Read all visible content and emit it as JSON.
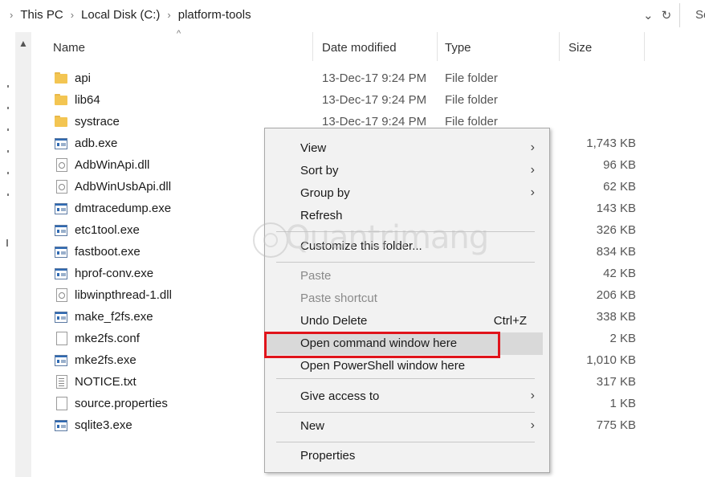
{
  "address": {
    "crumbs": [
      "This PC",
      "Local Disk (C:)",
      "platform-tools"
    ],
    "search_hint": "Se"
  },
  "columns": {
    "name": "Name",
    "date": "Date modified",
    "type": "Type",
    "size": "Size"
  },
  "files": [
    {
      "icon": "folder-icon",
      "name": "api",
      "date": "13-Dec-17 9:24 PM",
      "type": "File folder",
      "size": ""
    },
    {
      "icon": "folder-icon",
      "name": "lib64",
      "date": "13-Dec-17 9:24 PM",
      "type": "File folder",
      "size": ""
    },
    {
      "icon": "folder-icon",
      "name": "systrace",
      "date": "13-Dec-17 9:24 PM",
      "type": "File folder",
      "size": ""
    },
    {
      "icon": "exe-icon",
      "name": "adb.exe",
      "date": "",
      "type": "",
      "size": "1,743 KB"
    },
    {
      "icon": "dll-icon",
      "name": "AdbWinApi.dll",
      "date": "",
      "type": "",
      "size": "96 KB"
    },
    {
      "icon": "dll-icon",
      "name": "AdbWinUsbApi.dll",
      "date": "",
      "type": "",
      "size": "62 KB"
    },
    {
      "icon": "exe-icon",
      "name": "dmtracedump.exe",
      "date": "",
      "type": "",
      "size": "143 KB"
    },
    {
      "icon": "exe-icon",
      "name": "etc1tool.exe",
      "date": "",
      "type": "",
      "size": "326 KB"
    },
    {
      "icon": "exe-icon",
      "name": "fastboot.exe",
      "date": "",
      "type": "",
      "size": "834 KB"
    },
    {
      "icon": "exe-icon",
      "name": "hprof-conv.exe",
      "date": "",
      "type": "",
      "size": "42 KB"
    },
    {
      "icon": "dll-icon",
      "name": "libwinpthread-1.dll",
      "date": "",
      "type": "",
      "size": "206 KB"
    },
    {
      "icon": "exe-icon",
      "name": "make_f2fs.exe",
      "date": "",
      "type": "",
      "size": "338 KB"
    },
    {
      "icon": "document-icon",
      "name": "mke2fs.conf",
      "date": "",
      "type": "",
      "size": "2 KB"
    },
    {
      "icon": "exe-icon",
      "name": "mke2fs.exe",
      "date": "",
      "type": "",
      "size": "1,010 KB"
    },
    {
      "icon": "text-file-icon",
      "name": "NOTICE.txt",
      "date": "",
      "type": "",
      "size": "317 KB"
    },
    {
      "icon": "document-icon",
      "name": "source.properties",
      "date": "",
      "type": "",
      "size": "1 KB"
    },
    {
      "icon": "exe-icon",
      "name": "sqlite3.exe",
      "date": "",
      "type": "",
      "size": "775 KB"
    }
  ],
  "menu": {
    "view": "View",
    "sort_by": "Sort by",
    "group_by": "Group by",
    "refresh": "Refresh",
    "customize": "Customize this folder...",
    "paste": "Paste",
    "paste_shortcut": "Paste shortcut",
    "undo_delete": "Undo Delete",
    "undo_shortcut": "Ctrl+Z",
    "open_cmd": "Open command window here",
    "open_ps": "Open PowerShell window here",
    "give_access": "Give access to",
    "new": "New",
    "properties": "Properties"
  },
  "watermark": "Quantrimang",
  "colors": {
    "highlight_box": "#e0141b",
    "folder": "#f3c552",
    "menu_bg": "#f2f2f2"
  }
}
